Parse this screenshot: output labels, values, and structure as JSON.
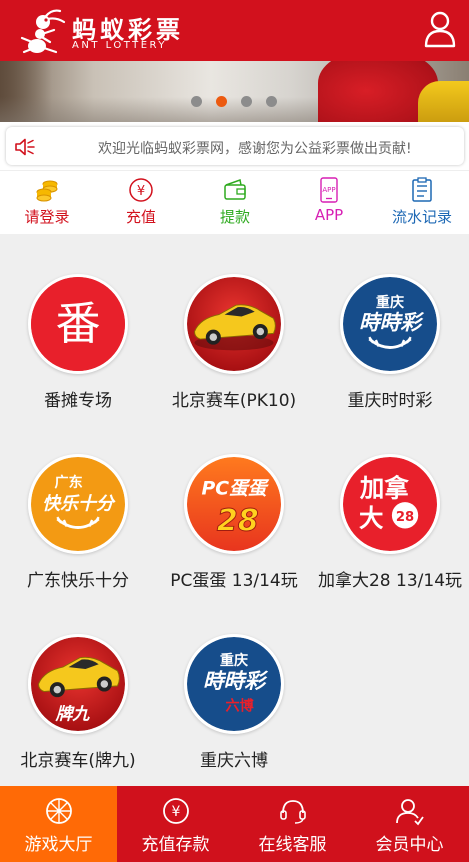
{
  "header": {
    "title": "蚂蚁彩票",
    "subtitle": "ANT LOTTERY",
    "user_icon": "user-icon"
  },
  "banner": {
    "slide_count": 4,
    "active_slide": 2
  },
  "notice": {
    "icon": "speaker-icon",
    "text": "欢迎光临蚂蚁彩票网，感谢您为公益彩票做出贡献!"
  },
  "quick_menu": [
    {
      "label": "请登录",
      "icon": "coins-icon",
      "color": "#d2111d"
    },
    {
      "label": "充值",
      "icon": "yuan-circle-icon",
      "color": "#d2111d"
    },
    {
      "label": "提款",
      "icon": "wallet-icon",
      "color": "#2eaa1f"
    },
    {
      "label": "APP",
      "icon": "app-phone-icon",
      "color": "#d71fb4"
    },
    {
      "label": "流水记录",
      "icon": "record-list-icon",
      "color": "#1d68b4"
    }
  ],
  "games": [
    {
      "label": "番摊专场",
      "logo_text": "番",
      "icon": "fantan-logo"
    },
    {
      "label": "北京赛车(PK10)",
      "icon": "sports-car-logo"
    },
    {
      "label": "重庆时时彩",
      "logo_top": "重庆",
      "logo_main": "時時彩",
      "icon": "cqssc-logo"
    },
    {
      "label": "广东快乐十分",
      "logo_top": "广东",
      "logo_main": "快乐十分",
      "icon": "gdklsf-logo"
    },
    {
      "label": "PC蛋蛋 13/14玩",
      "logo_top": "PC蛋蛋",
      "logo_main": "28",
      "icon": "pcdd-logo"
    },
    {
      "label": "加拿大28 13/14玩",
      "logo_top": "加拿",
      "logo_main": "大",
      "logo_badge": "28",
      "icon": "canada28-logo"
    },
    {
      "label": "北京赛车(牌九)",
      "logo_main": "牌九",
      "icon": "sports-car-paijiu-logo"
    },
    {
      "label": "重庆六博",
      "logo_top": "重庆",
      "logo_main": "時時彩",
      "logo_sub": "六博",
      "icon": "cq-liubo-logo"
    }
  ],
  "bottom_nav": [
    {
      "label": "游戏大厅",
      "icon": "game-hall-icon",
      "active": true
    },
    {
      "label": "充值存款",
      "icon": "yuan-circle-icon",
      "active": false
    },
    {
      "label": "在线客服",
      "icon": "headset-icon",
      "active": false
    },
    {
      "label": "会员中心",
      "icon": "member-icon",
      "active": false
    }
  ],
  "colors": {
    "brand_red": "#d2111d",
    "active_orange": "#ff6a06",
    "background": "#efefef"
  }
}
